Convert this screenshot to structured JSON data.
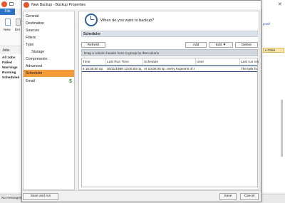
{
  "background_app": {
    "file_tab": "File",
    "new_button": "New",
    "em_label": "Em",
    "jobs_header": "Jobs",
    "sidebar_items": [
      "All Jobs",
      "Failed",
      "Warnings",
      "Running",
      "Scheduled"
    ],
    "right_text": "p4all",
    "order_button": "e Order",
    "status": "No messages"
  },
  "dialog": {
    "title": "New Backup - Backup Properties",
    "question": "When do you want to backup?",
    "nav_items": [
      {
        "label": "General",
        "sub": false
      },
      {
        "label": "Destination",
        "sub": false
      },
      {
        "label": "Sources",
        "sub": false
      },
      {
        "label": "Filters",
        "sub": false
      },
      {
        "label": "Type",
        "sub": false
      },
      {
        "label": "Storage",
        "sub": true
      },
      {
        "label": "Compression",
        "sub": false
      },
      {
        "label": "Advanced",
        "sub": false
      },
      {
        "label": "Scheduler",
        "sub": false,
        "selected": true
      },
      {
        "label": "Email",
        "sub": false
      }
    ],
    "section_title": "Scheduler",
    "toolbar": {
      "refresh": "Refresh",
      "add": "Add",
      "edit": "Edit",
      "edit_arrow": "▼",
      "delete": "Delete"
    },
    "group_hint": "Drag a column header here to group by that column",
    "columns": [
      "Time",
      "Last Run Time",
      "Schedule",
      "User",
      "Last run res"
    ],
    "rows": [
      [
        "6 10:00:00 пр.",
        "30/11/1999 12:00:00 пр.",
        "At 10:00:00 пр. every Kupenrni of ev John",
        "",
        "The task ha"
      ]
    ],
    "footer": {
      "save_and_run": "Save and run",
      "save": "Save",
      "cancel": "Cancel"
    }
  }
}
